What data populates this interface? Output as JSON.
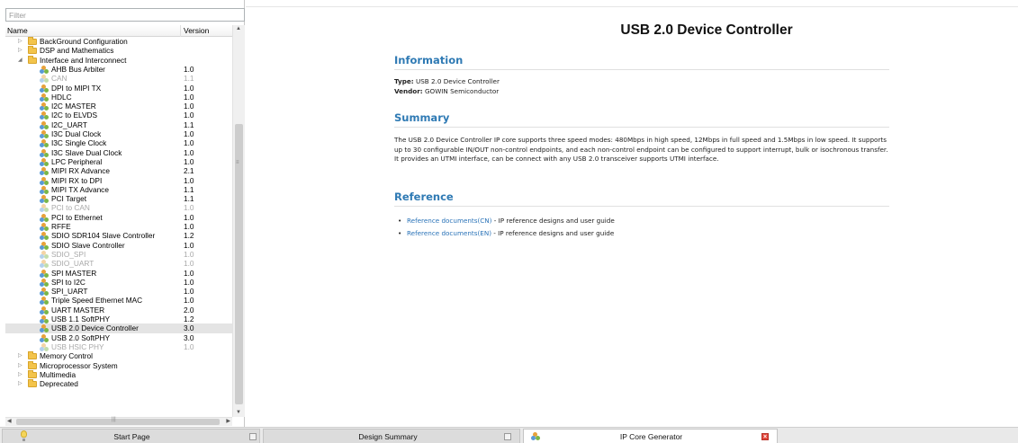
{
  "filter": {
    "placeholder": "Filter",
    "value": ""
  },
  "tree": {
    "header": {
      "name": "Name",
      "version": "Version"
    },
    "rows": [
      {
        "label": "BackGround Configuration",
        "version": "",
        "type": "folder",
        "level": 0,
        "expanded": false,
        "disabled": false,
        "selected": false
      },
      {
        "label": "DSP and Mathematics",
        "version": "",
        "type": "folder",
        "level": 0,
        "expanded": false,
        "disabled": false,
        "selected": false
      },
      {
        "label": "Interface and Interconnect",
        "version": "",
        "type": "folder",
        "level": 0,
        "expanded": true,
        "disabled": false,
        "selected": false
      },
      {
        "label": "AHB Bus Arbiter",
        "version": "1.0",
        "type": "ip",
        "level": 1,
        "disabled": false,
        "selected": false
      },
      {
        "label": "CAN",
        "version": "1.1",
        "type": "ip",
        "level": 1,
        "disabled": true,
        "selected": false
      },
      {
        "label": "DPI to MIPI TX",
        "version": "1.0",
        "type": "ip",
        "level": 1,
        "disabled": false,
        "selected": false
      },
      {
        "label": "HDLC",
        "version": "1.0",
        "type": "ip",
        "level": 1,
        "disabled": false,
        "selected": false
      },
      {
        "label": "I2C MASTER",
        "version": "1.0",
        "type": "ip",
        "level": 1,
        "disabled": false,
        "selected": false
      },
      {
        "label": "I2C to ELVDS",
        "version": "1.0",
        "type": "ip",
        "level": 1,
        "disabled": false,
        "selected": false
      },
      {
        "label": "I2C_UART",
        "version": "1.1",
        "type": "ip",
        "level": 1,
        "disabled": false,
        "selected": false
      },
      {
        "label": "I3C Dual Clock",
        "version": "1.0",
        "type": "ip",
        "level": 1,
        "disabled": false,
        "selected": false
      },
      {
        "label": "I3C Single Clock",
        "version": "1.0",
        "type": "ip",
        "level": 1,
        "disabled": false,
        "selected": false
      },
      {
        "label": "I3C Slave Dual Clock",
        "version": "1.0",
        "type": "ip",
        "level": 1,
        "disabled": false,
        "selected": false
      },
      {
        "label": "LPC Peripheral",
        "version": "1.0",
        "type": "ip",
        "level": 1,
        "disabled": false,
        "selected": false
      },
      {
        "label": "MIPI RX Advance",
        "version": "2.1",
        "type": "ip",
        "level": 1,
        "disabled": false,
        "selected": false
      },
      {
        "label": "MIPI RX to DPI",
        "version": "1.0",
        "type": "ip",
        "level": 1,
        "disabled": false,
        "selected": false
      },
      {
        "label": "MIPI TX Advance",
        "version": "1.1",
        "type": "ip",
        "level": 1,
        "disabled": false,
        "selected": false
      },
      {
        "label": "PCI Target",
        "version": "1.1",
        "type": "ip",
        "level": 1,
        "disabled": false,
        "selected": false
      },
      {
        "label": "PCI to CAN",
        "version": "1.0",
        "type": "ip",
        "level": 1,
        "disabled": true,
        "selected": false
      },
      {
        "label": "PCI to Ethernet",
        "version": "1.0",
        "type": "ip",
        "level": 1,
        "disabled": false,
        "selected": false
      },
      {
        "label": "RFFE",
        "version": "1.0",
        "type": "ip",
        "level": 1,
        "disabled": false,
        "selected": false
      },
      {
        "label": "SDIO SDR104 Slave Controller",
        "version": "1.2",
        "type": "ip",
        "level": 1,
        "disabled": false,
        "selected": false
      },
      {
        "label": "SDIO Slave Controller",
        "version": "1.0",
        "type": "ip",
        "level": 1,
        "disabled": false,
        "selected": false
      },
      {
        "label": "SDIO_SPI",
        "version": "1.0",
        "type": "ip",
        "level": 1,
        "disabled": true,
        "selected": false
      },
      {
        "label": "SDIO_UART",
        "version": "1.0",
        "type": "ip",
        "level": 1,
        "disabled": true,
        "selected": false
      },
      {
        "label": "SPI MASTER",
        "version": "1.0",
        "type": "ip",
        "level": 1,
        "disabled": false,
        "selected": false
      },
      {
        "label": "SPI to I2C",
        "version": "1.0",
        "type": "ip",
        "level": 1,
        "disabled": false,
        "selected": false
      },
      {
        "label": "SPI_UART",
        "version": "1.0",
        "type": "ip",
        "level": 1,
        "disabled": false,
        "selected": false
      },
      {
        "label": "Triple Speed Ethernet MAC",
        "version": "1.0",
        "type": "ip",
        "level": 1,
        "disabled": false,
        "selected": false
      },
      {
        "label": "UART MASTER",
        "version": "2.0",
        "type": "ip",
        "level": 1,
        "disabled": false,
        "selected": false
      },
      {
        "label": "USB 1.1 SoftPHY",
        "version": "1.2",
        "type": "ip",
        "level": 1,
        "disabled": false,
        "selected": false
      },
      {
        "label": "USB 2.0 Device Controller",
        "version": "3.0",
        "type": "ip",
        "level": 1,
        "disabled": false,
        "selected": true
      },
      {
        "label": "USB 2.0 SoftPHY",
        "version": "3.0",
        "type": "ip",
        "level": 1,
        "disabled": false,
        "selected": false
      },
      {
        "label": "USB HSIC PHY",
        "version": "1.0",
        "type": "ip",
        "level": 1,
        "disabled": true,
        "selected": false
      },
      {
        "label": "Memory Control",
        "version": "",
        "type": "folder",
        "level": 0,
        "expanded": false,
        "disabled": false,
        "selected": false
      },
      {
        "label": "Microprocessor System",
        "version": "",
        "type": "folder",
        "level": 0,
        "expanded": false,
        "disabled": false,
        "selected": false
      },
      {
        "label": "Multimedia",
        "version": "",
        "type": "folder",
        "level": 0,
        "expanded": false,
        "disabled": false,
        "selected": false
      },
      {
        "label": "Deprecated",
        "version": "",
        "type": "folder",
        "level": 0,
        "expanded": false,
        "disabled": false,
        "selected": false
      }
    ]
  },
  "document": {
    "title": "USB 2.0 Device Controller",
    "information": {
      "heading": "Information",
      "type_label": "Type:",
      "type_value": "USB 2.0 Device Controller",
      "vendor_label": "Vendor:",
      "vendor_value": "GOWIN Semiconductor"
    },
    "summary": {
      "heading": "Summary",
      "text": "The USB 2.0 Device Controller IP core supports three speed modes: 480Mbps in high speed, 12Mbps in full speed and 1.5Mbps in low speed. It supports up to 30 configurable IN/OUT non-control endpoints, and each non-control endpoint can be configured to support interrupt, bulk or isochronous transfer. It provides an UTMI interface, can be connect with any USB 2.0 transceiver supports UTMI interface."
    },
    "reference": {
      "heading": "Reference",
      "items": [
        {
          "link": "Reference documents(CN)",
          "desc": " - IP reference designs and user guide"
        },
        {
          "link": "Reference documents(EN)",
          "desc": " - IP reference designs and user guide"
        }
      ]
    }
  },
  "tabs": [
    {
      "label": "Start Page",
      "icon": "lightbulb-icon",
      "active": false
    },
    {
      "label": "Design Summary",
      "icon": "",
      "active": false
    },
    {
      "label": "IP Core Generator",
      "icon": "ip-core-icon",
      "active": true
    }
  ],
  "colors": {
    "heading_blue": "#2f7ab4",
    "link_blue": "#2a73b8",
    "folder_yellow": "#f3c44b",
    "selected_row": "#e4e4e4",
    "disabled_text": "#a8a8a8",
    "close_red": "#e2463a"
  }
}
